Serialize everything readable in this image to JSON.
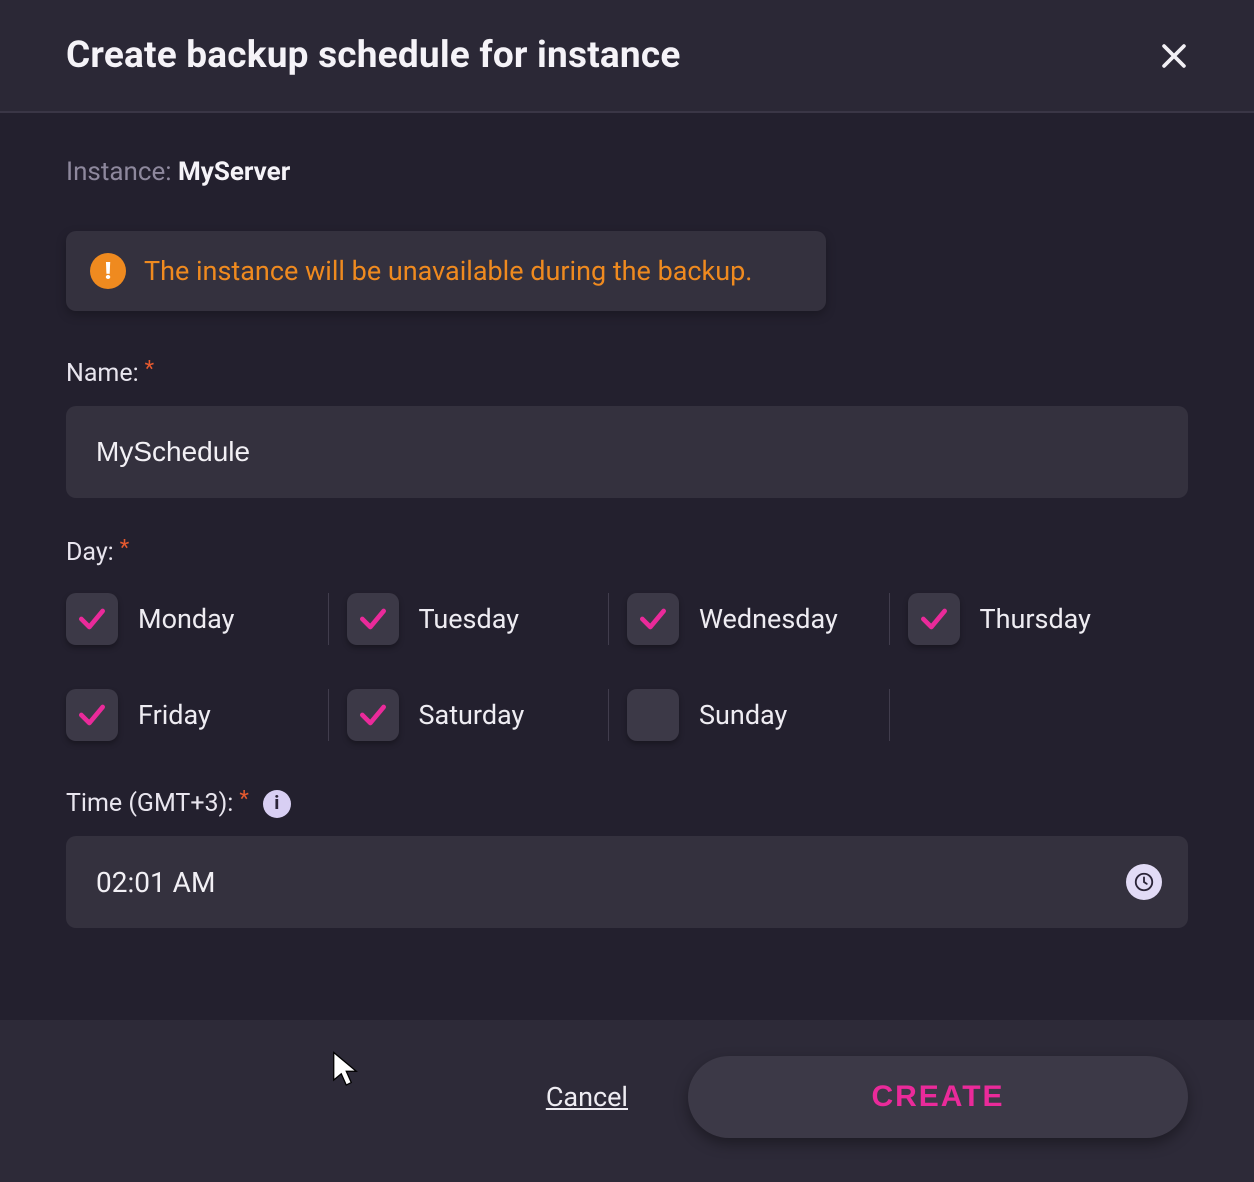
{
  "header": {
    "title": "Create backup schedule for instance"
  },
  "instance": {
    "label": "Instance:",
    "name": "MyServer"
  },
  "alert": {
    "text": "The instance will be unavailable during the backup."
  },
  "name_field": {
    "label": "Name:",
    "value": "MySchedule"
  },
  "day_field": {
    "label": "Day:",
    "days": [
      {
        "label": "Monday",
        "checked": true
      },
      {
        "label": "Tuesday",
        "checked": true
      },
      {
        "label": "Wednesday",
        "checked": true
      },
      {
        "label": "Thursday",
        "checked": true
      },
      {
        "label": "Friday",
        "checked": true
      },
      {
        "label": "Saturday",
        "checked": true
      },
      {
        "label": "Sunday",
        "checked": false
      }
    ]
  },
  "time_field": {
    "label": "Time (GMT+3):",
    "value": "02:01 AM"
  },
  "footer": {
    "cancel": "Cancel",
    "create": "CREATE"
  }
}
